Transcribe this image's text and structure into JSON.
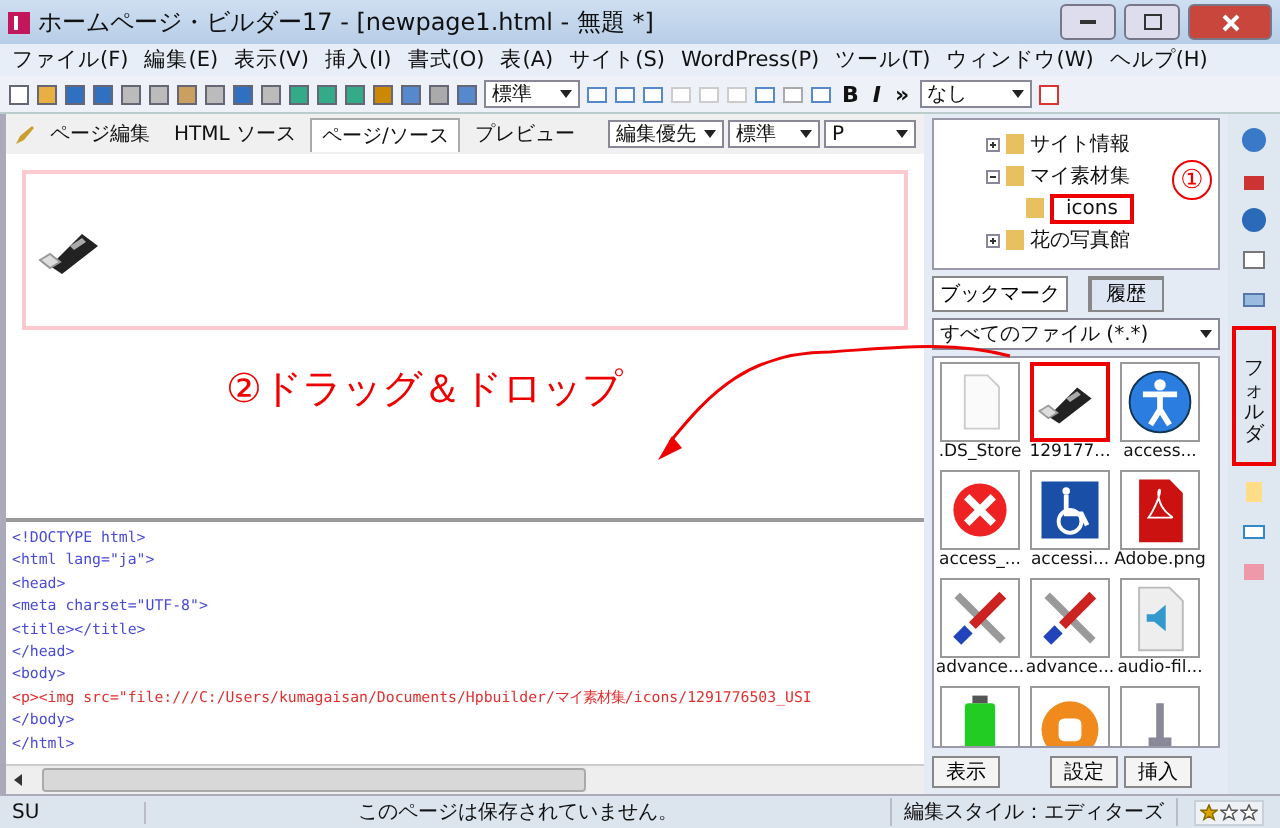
{
  "window": {
    "title": "ホームページ・ビルダー17 - [newpage1.html - 無題 *]"
  },
  "menu": [
    "ファイル(F)",
    "編集(E)",
    "表示(V)",
    "挿入(I)",
    "書式(O)",
    "表(A)",
    "サイト(S)",
    "WordPress(P)",
    "ツール(T)",
    "ウィンドウ(W)",
    "ヘルプ(H)"
  ],
  "toolbar": {
    "style_select": "標準",
    "text_buttons": [
      "B",
      "I",
      "»"
    ],
    "class_select": "なし"
  },
  "editor_tabs": [
    {
      "label": "ページ編集",
      "selected": false
    },
    {
      "label": "HTML ソース",
      "selected": false
    },
    {
      "label": "ページ/ソース",
      "selected": true
    },
    {
      "label": "プレビュー",
      "selected": false
    }
  ],
  "editor_selects": [
    "編集優先",
    "標準",
    "P"
  ],
  "design_view": {
    "annotation": "②ドラッグ＆ドロップ"
  },
  "source_lines": [
    {
      "text": "<!DOCTYPE html>",
      "kind": "markup"
    },
    {
      "text": "<html lang=\"ja\">",
      "kind": "markup"
    },
    {
      "text": "<head>",
      "kind": "markup"
    },
    {
      "text": "<meta charset=\"UTF-8\">",
      "kind": "markup"
    },
    {
      "text": "<title></title>",
      "kind": "markup"
    },
    {
      "text": "</head>",
      "kind": "markup"
    },
    {
      "text": "<body>",
      "kind": "markup"
    },
    {
      "text": "<p><img src=\"file:///C:/Users/kumagaisan/Documents/Hpbuilder/マイ素材集/icons/1291776503_USI",
      "kind": "inserted"
    },
    {
      "text": "</body>",
      "kind": "markup"
    },
    {
      "text": "</html>",
      "kind": "markup"
    }
  ],
  "folder_tree": [
    {
      "label": "サイト情報",
      "expanded": false,
      "selected": false
    },
    {
      "label": "マイ素材集",
      "expanded": true,
      "selected": false,
      "children": [
        {
          "label": "icons",
          "selected": true
        }
      ]
    },
    {
      "label": "花の写真館",
      "expanded": false,
      "selected": false
    }
  ],
  "tree_annotation": "①",
  "panel_tabs": [
    {
      "label": "ブックマーク",
      "selected": false
    },
    {
      "label": "履歴",
      "selected": true
    }
  ],
  "file_filter": "すべてのファイル (*.*)",
  "files": [
    {
      "name": ".DS_Store",
      "kind": "blank",
      "selected": false
    },
    {
      "name": "129177...",
      "kind": "usb",
      "selected": true
    },
    {
      "name": "access...",
      "kind": "person",
      "selected": false
    },
    {
      "name": "access_...",
      "kind": "cross",
      "selected": false
    },
    {
      "name": "accessi...",
      "kind": "wheelchair",
      "selected": false
    },
    {
      "name": "Adobe.png",
      "kind": "pdf",
      "selected": false
    },
    {
      "name": "advance...",
      "kind": "tools",
      "selected": false
    },
    {
      "name": "advance...",
      "kind": "tools",
      "selected": false
    },
    {
      "name": "audio-fil...",
      "kind": "speaker",
      "selected": false
    },
    {
      "kind": "battery",
      "selected": false
    },
    {
      "kind": "blog",
      "selected": false
    },
    {
      "kind": "tower",
      "selected": false
    }
  ],
  "panel_buttons": [
    "表示",
    "設定",
    "挿入"
  ],
  "side_tab": {
    "label": "フォルダ",
    "highlighted": true
  },
  "status_bar": {
    "mode": "SU",
    "message": "このページは保存されていません。",
    "style": "編集スタイル：エディターズ",
    "stars": 1
  }
}
